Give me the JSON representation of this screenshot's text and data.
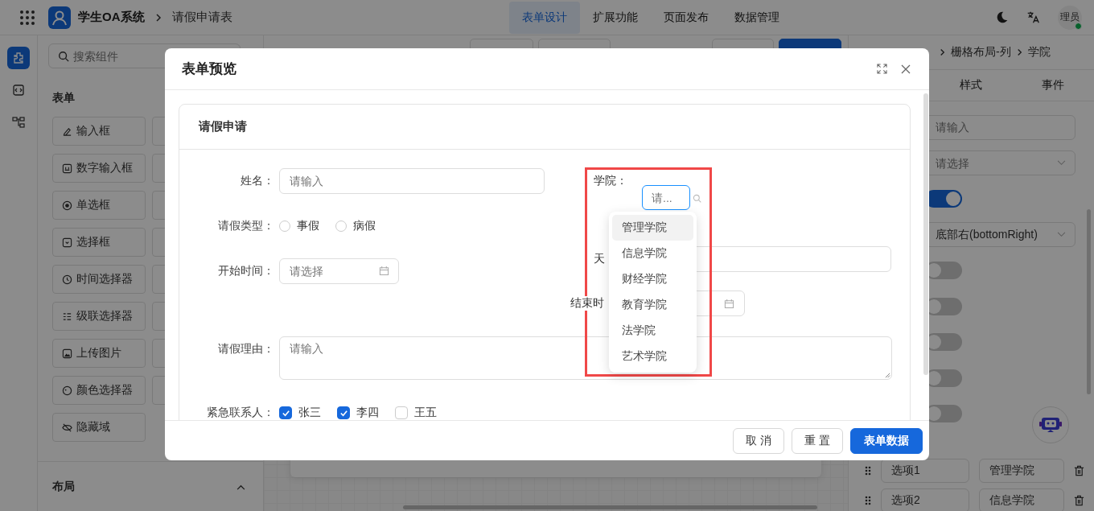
{
  "header": {
    "app_name": "学生OA系统",
    "page_title": "请假申请表",
    "avatar": "理员",
    "tabs": [
      {
        "label": "表单设计",
        "selected": true
      },
      {
        "label": "扩展功能",
        "selected": false
      },
      {
        "label": "页面发布",
        "selected": false
      },
      {
        "label": "数据管理",
        "selected": false
      }
    ]
  },
  "rail": [
    {
      "kind": "widgets",
      "selected": true
    },
    {
      "kind": "code",
      "selected": false
    },
    {
      "kind": "tree",
      "selected": false
    }
  ],
  "component_panel": {
    "search_placeholder": "搜索组件",
    "section_title": "表单",
    "collapsed_title": "布局",
    "items": [
      {
        "kind": "input",
        "label": "输入框"
      },
      {
        "kind": "number",
        "label": "数字输入框"
      },
      {
        "kind": "radio",
        "label": "单选框"
      },
      {
        "kind": "select",
        "label": "选择框"
      },
      {
        "kind": "time",
        "label": "时间选择器"
      },
      {
        "kind": "cascader",
        "label": "级联选择器"
      },
      {
        "kind": "upload",
        "label": "上传图片"
      },
      {
        "kind": "color",
        "label": "颜色选择器"
      },
      {
        "kind": "hidden",
        "label": "隐藏域"
      }
    ]
  },
  "properties_panel": {
    "breadcrumb": [
      "栅格布局-列",
      "学院"
    ],
    "tabs": [
      "样式",
      "事件"
    ],
    "fields": [
      {
        "kind": "input",
        "placeholder": "请输入"
      },
      {
        "kind": "select",
        "placeholder": "请选择"
      },
      {
        "kind": "switch",
        "on": true
      },
      {
        "kind": "select",
        "value": "底部右(bottomRight)"
      },
      {
        "kind": "switch",
        "on": false
      },
      {
        "kind": "switch",
        "on": false
      },
      {
        "kind": "switch",
        "on": false
      },
      {
        "kind": "switch",
        "on": false
      },
      {
        "kind": "switch",
        "on": false
      }
    ],
    "options": [
      {
        "label": "选项1",
        "value": "管理学院"
      },
      {
        "label": "选项2",
        "value": "信息学院"
      }
    ]
  },
  "modal": {
    "title": "表单预览",
    "card_title": "请假申请",
    "name": {
      "label": "姓名：",
      "placeholder": "请输入"
    },
    "leave_type": {
      "label": "请假类型：",
      "options": [
        {
          "label": "事假",
          "checked": false
        },
        {
          "label": "病假",
          "checked": false
        }
      ]
    },
    "start_time": {
      "label": "开始时间：",
      "placeholder": "请选择"
    },
    "college": {
      "label": "学院：",
      "placeholder": "请...",
      "options": [
        {
          "label": "管理学院",
          "selected": true
        },
        {
          "label": "信息学院",
          "selected": false
        },
        {
          "label": "财经学院",
          "selected": false
        },
        {
          "label": "教育学院",
          "selected": false
        },
        {
          "label": "法学院",
          "selected": false
        },
        {
          "label": "艺术学院",
          "selected": false
        }
      ]
    },
    "days": {
      "label": "天"
    },
    "end_time": {
      "label": "结束时"
    },
    "reason": {
      "label": "请假理由：",
      "placeholder": "请输入"
    },
    "contacts": {
      "label": "紧急联系人：",
      "options": [
        {
          "label": "张三",
          "checked": true
        },
        {
          "label": "李四",
          "checked": true
        },
        {
          "label": "王五",
          "checked": false
        }
      ]
    },
    "buttons": [
      {
        "kind": "default",
        "label": "取 消"
      },
      {
        "kind": "default",
        "label": "重 置"
      },
      {
        "kind": "primary",
        "label": "表单数据"
      }
    ]
  }
}
